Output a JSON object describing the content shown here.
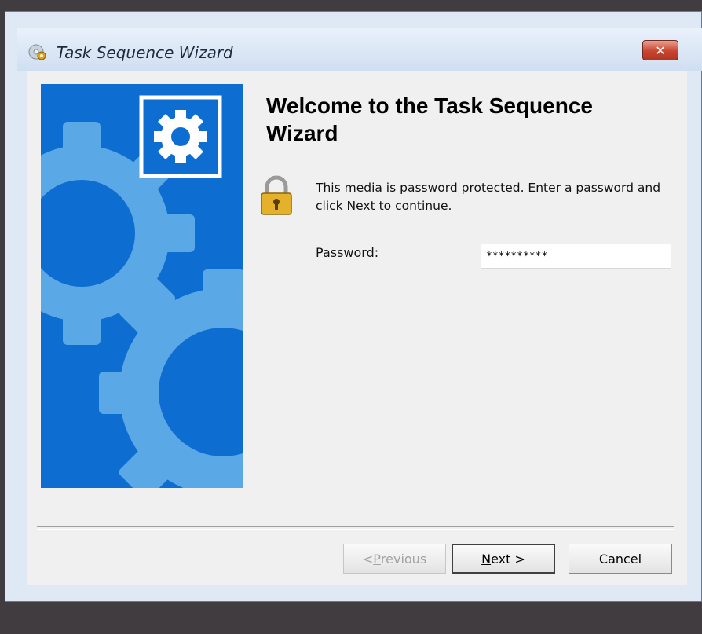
{
  "window": {
    "title": "Task Sequence Wizard",
    "close_label": "✕",
    "title_icon": "disc-gear-icon"
  },
  "main": {
    "heading": "Welcome to the Task Sequence Wizard",
    "message": "This media is password protected.  Enter a password and click Next to continue.",
    "password_label_accel": "P",
    "password_label_rest": "assword:",
    "password_value": "**********",
    "lock_icon": "padlock-icon"
  },
  "buttons": {
    "previous_pre": "< ",
    "previous_accel": "P",
    "previous_rest": "revious",
    "next_accel": "N",
    "next_rest": "ext >",
    "cancel": "Cancel"
  },
  "colors": {
    "side_panel": "#0e6dd0",
    "gear": "#5aa8e6",
    "desktop": "#403c40"
  }
}
